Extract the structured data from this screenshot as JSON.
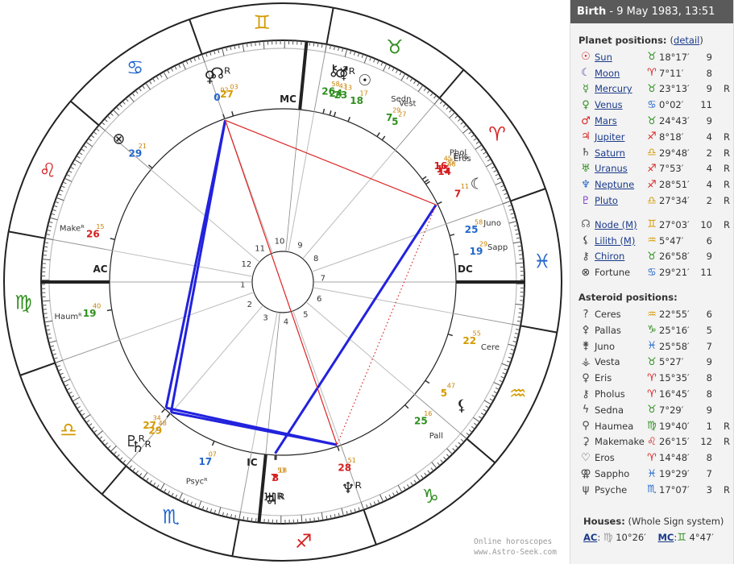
{
  "header": {
    "title_bold": "Birth",
    "title_rest": " - 9 May 1983, 13:51"
  },
  "planets_title": "Planet positions:",
  "detail_link": "detail",
  "asteroids_title": "Asteroid positions:",
  "houses": {
    "title": "Houses:",
    "system": "(Whole Sign system)",
    "ac_label": "AC",
    "ac_value": "10°26′",
    "ac_sign": "Virgo",
    "mc_label": "MC",
    "mc_value": "4°47′",
    "mc_sign": "Gemini"
  },
  "footer": {
    "line1": "Online horoscopes",
    "line2": "www.Astro-Seek.com"
  },
  "sign_colors": {
    "fire": "#d42020",
    "earth": "#2f8f1f",
    "air": "#d49a00",
    "water": "#2266cc"
  },
  "signs": [
    "Aries",
    "Taurus",
    "Gemini",
    "Cancer",
    "Leo",
    "Virgo",
    "Libra",
    "Scorpio",
    "Sagittarius",
    "Capricorn",
    "Aquarius",
    "Pisces"
  ],
  "planets": [
    {
      "icon": "☉",
      "icon_name": "sun-icon",
      "color": "#d42020",
      "name": "Sun",
      "sign": "Taurus",
      "deg": "18°17′",
      "house": "9",
      "r": ""
    },
    {
      "icon": "☾",
      "icon_name": "moon-icon",
      "color": "#5533aa",
      "name": "Moon",
      "sign": "Aries",
      "deg": "7°11′",
      "house": "8",
      "r": ""
    },
    {
      "icon": "☿",
      "icon_name": "mercury-icon",
      "color": "#2f8f1f",
      "name": "Mercury",
      "sign": "Taurus",
      "deg": "23°13′",
      "house": "9",
      "r": "R"
    },
    {
      "icon": "♀",
      "icon_name": "venus-icon",
      "color": "#2f8f1f",
      "name": "Venus",
      "sign": "Cancer",
      "deg": "0°02′",
      "house": "11",
      "r": ""
    },
    {
      "icon": "♂",
      "icon_name": "mars-icon",
      "color": "#d42020",
      "name": "Mars",
      "sign": "Taurus",
      "deg": "24°43′",
      "house": "9",
      "r": ""
    },
    {
      "icon": "♃",
      "icon_name": "jupiter-icon",
      "color": "#d42020",
      "name": "Jupiter",
      "sign": "Sagittarius",
      "deg": "8°18′",
      "house": "4",
      "r": "R"
    },
    {
      "icon": "♄",
      "icon_name": "saturn-icon",
      "color": "#444",
      "name": "Saturn",
      "sign": "Libra",
      "deg": "29°48′",
      "house": "2",
      "r": "R"
    },
    {
      "icon": "♅",
      "icon_name": "uranus-icon",
      "color": "#2f8f1f",
      "name": "Uranus",
      "sign": "Sagittarius",
      "deg": "7°53′",
      "house": "4",
      "r": "R"
    },
    {
      "icon": "♆",
      "icon_name": "neptune-icon",
      "color": "#2266cc",
      "name": "Neptune",
      "sign": "Sagittarius",
      "deg": "28°51′",
      "house": "4",
      "r": "R"
    },
    {
      "icon": "♇",
      "icon_name": "pluto-icon",
      "color": "#7733cc",
      "name": "Pluto",
      "sign": "Libra",
      "deg": "27°34′",
      "house": "2",
      "r": "R"
    }
  ],
  "points": [
    {
      "icon": "☊",
      "icon_name": "node-icon",
      "color": "#666",
      "name": "Node (M)",
      "sign": "Gemini",
      "deg": "27°03′",
      "house": "10",
      "r": "R"
    },
    {
      "icon": "⚸",
      "icon_name": "lilith-icon",
      "color": "#444",
      "name": "Lilith (M)",
      "sign": "Aquarius",
      "deg": "5°47′",
      "house": "6",
      "r": ""
    },
    {
      "icon": "⚷",
      "icon_name": "chiron-icon",
      "color": "#444",
      "name": "Chiron",
      "sign": "Taurus",
      "deg": "26°58′",
      "house": "9",
      "r": ""
    },
    {
      "icon": "⊗",
      "icon_name": "fortune-icon",
      "color": "#333",
      "name": "Fortune",
      "sign": "Cancer",
      "deg": "29°21′",
      "house": "11",
      "r": "",
      "plain": true
    }
  ],
  "asteroids": [
    {
      "icon": "?",
      "icon_name": "ceres-icon",
      "name": "Ceres",
      "label": "Cere",
      "sign": "Aquarius",
      "deg": "22°55′",
      "house": "6",
      "r": ""
    },
    {
      "icon": "⚴",
      "icon_name": "pallas-icon",
      "name": "Pallas",
      "label": "Pall",
      "sign": "Capricorn",
      "deg": "25°16′",
      "house": "5",
      "r": ""
    },
    {
      "icon": "⚵",
      "icon_name": "juno-icon",
      "name": "Juno",
      "label": "Juno",
      "sign": "Pisces",
      "deg": "25°58′",
      "house": "7",
      "r": ""
    },
    {
      "icon": "⚶",
      "icon_name": "vesta-icon",
      "name": "Vesta",
      "label": "Vest",
      "sign": "Taurus",
      "deg": "5°27′",
      "house": "9",
      "r": ""
    },
    {
      "icon": "♀",
      "icon_name": "eris-icon",
      "name": "Eris",
      "label": "Eris",
      "sign": "Aries",
      "deg": "15°35′",
      "house": "8",
      "r": ""
    },
    {
      "icon": "⚷",
      "icon_name": "pholus-icon",
      "name": "Pholus",
      "label": "Phol",
      "sign": "Aries",
      "deg": "16°45′",
      "house": "8",
      "r": ""
    },
    {
      "icon": "ϟ",
      "icon_name": "sedna-icon",
      "name": "Sedna",
      "label": "Sedn",
      "sign": "Taurus",
      "deg": "7°29′",
      "house": "9",
      "r": ""
    },
    {
      "icon": "⚲",
      "icon_name": "haumea-icon",
      "name": "Haumea",
      "label": "Haum",
      "sign": "Virgo",
      "deg": "19°40′",
      "house": "1",
      "r": "R"
    },
    {
      "icon": "⚳",
      "icon_name": "makemake-icon",
      "name": "Makemake",
      "label": "Make",
      "sign": "Leo",
      "deg": "26°15′",
      "house": "12",
      "r": "R"
    },
    {
      "icon": "♡",
      "icon_name": "eros-icon",
      "name": "Eros",
      "label": "Eros",
      "sign": "Aries",
      "deg": "14°48′",
      "house": "8",
      "r": ""
    },
    {
      "icon": "⚢",
      "icon_name": "sappho-icon",
      "name": "Sappho",
      "label": "Sapp",
      "sign": "Pisces",
      "deg": "19°29′",
      "house": "7",
      "r": ""
    },
    {
      "icon": "ψ",
      "icon_name": "psyche-icon",
      "name": "Psyche",
      "label": "Psyc",
      "sign": "Scorpio",
      "deg": "17°07′",
      "house": "3",
      "r": "R"
    }
  ],
  "angles": {
    "ac": "AC",
    "dc": "DC",
    "mc": "MC",
    "ic": "IC"
  },
  "aspects": [
    {
      "a": "Venus",
      "b": "Pluto",
      "color": "#2222dd"
    },
    {
      "a": "Venus",
      "b": "Saturn",
      "color": "#2222dd"
    },
    {
      "a": "Pluto",
      "b": "Neptune",
      "color": "#2222dd"
    },
    {
      "a": "Saturn",
      "b": "Neptune",
      "color": "#2222dd"
    },
    {
      "a": "Uranus",
      "b": "Moon",
      "color": "#2222dd"
    },
    {
      "a": "Venus",
      "b": "Moon",
      "color": "#dd2222"
    },
    {
      "a": "Venus",
      "b": "Neptune",
      "color": "#dd2222"
    },
    {
      "a": "Moon",
      "b": "Neptune",
      "color": "#dd2222",
      "dotted": true
    }
  ]
}
